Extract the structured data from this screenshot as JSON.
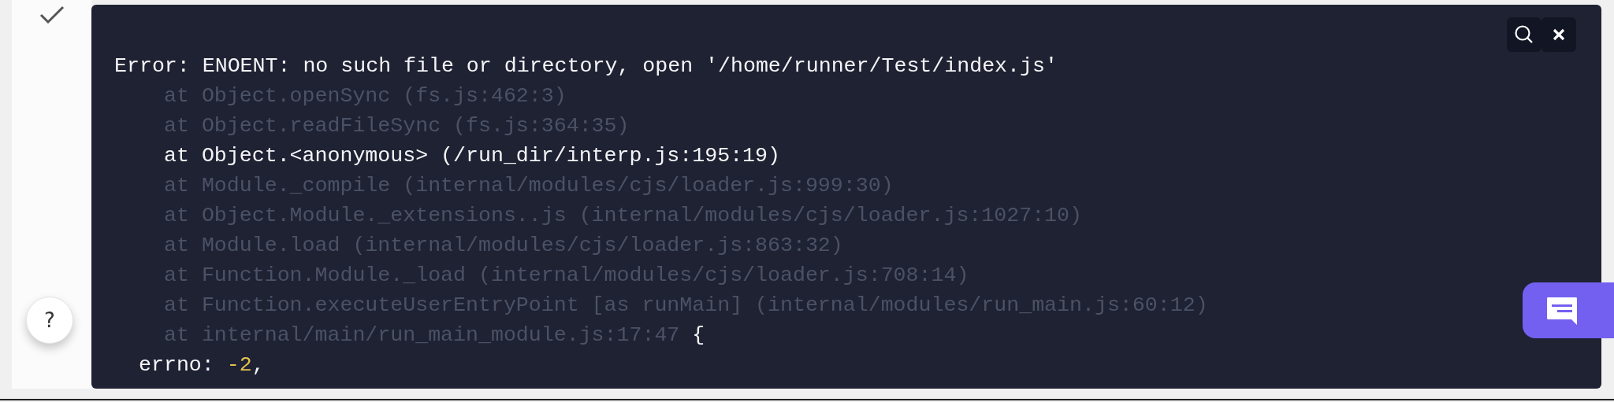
{
  "status": {
    "done": true
  },
  "console": {
    "lines": [
      {
        "kind": "message",
        "text": "Error: ENOENT: no such file or directory, open '/home/runner/Test/index.js'"
      },
      {
        "kind": "frame",
        "text": "at Object.openSync (fs.js:462:3)",
        "dimmed": true
      },
      {
        "kind": "frame",
        "text": "at Object.readFileSync (fs.js:364:35)",
        "dimmed": true
      },
      {
        "kind": "frame",
        "text": "at Object.<anonymous> (/run_dir/interp.js:195:19)",
        "dimmed": false
      },
      {
        "kind": "frame",
        "text": "at Module._compile (internal/modules/cjs/loader.js:999:30)",
        "dimmed": true
      },
      {
        "kind": "frame",
        "text": "at Object.Module._extensions..js (internal/modules/cjs/loader.js:1027:10)",
        "dimmed": true
      },
      {
        "kind": "frame",
        "text": "at Module.load (internal/modules/cjs/loader.js:863:32)",
        "dimmed": true
      },
      {
        "kind": "frame",
        "text": "at Function.Module._load (internal/modules/cjs/loader.js:708:14)",
        "dimmed": true
      },
      {
        "kind": "frame",
        "text": "at Function.executeUserEntryPoint [as runMain] (internal/modules/run_main.js:60:12)",
        "dimmed": true
      },
      {
        "kind": "frame",
        "text": "at internal/main/run_main_module.js:17:47",
        "dimmed": true,
        "tail": "{"
      },
      {
        "kind": "property",
        "key": "errno:",
        "value": "-2",
        "tail": ","
      }
    ]
  },
  "help_button": {
    "label": "?"
  }
}
